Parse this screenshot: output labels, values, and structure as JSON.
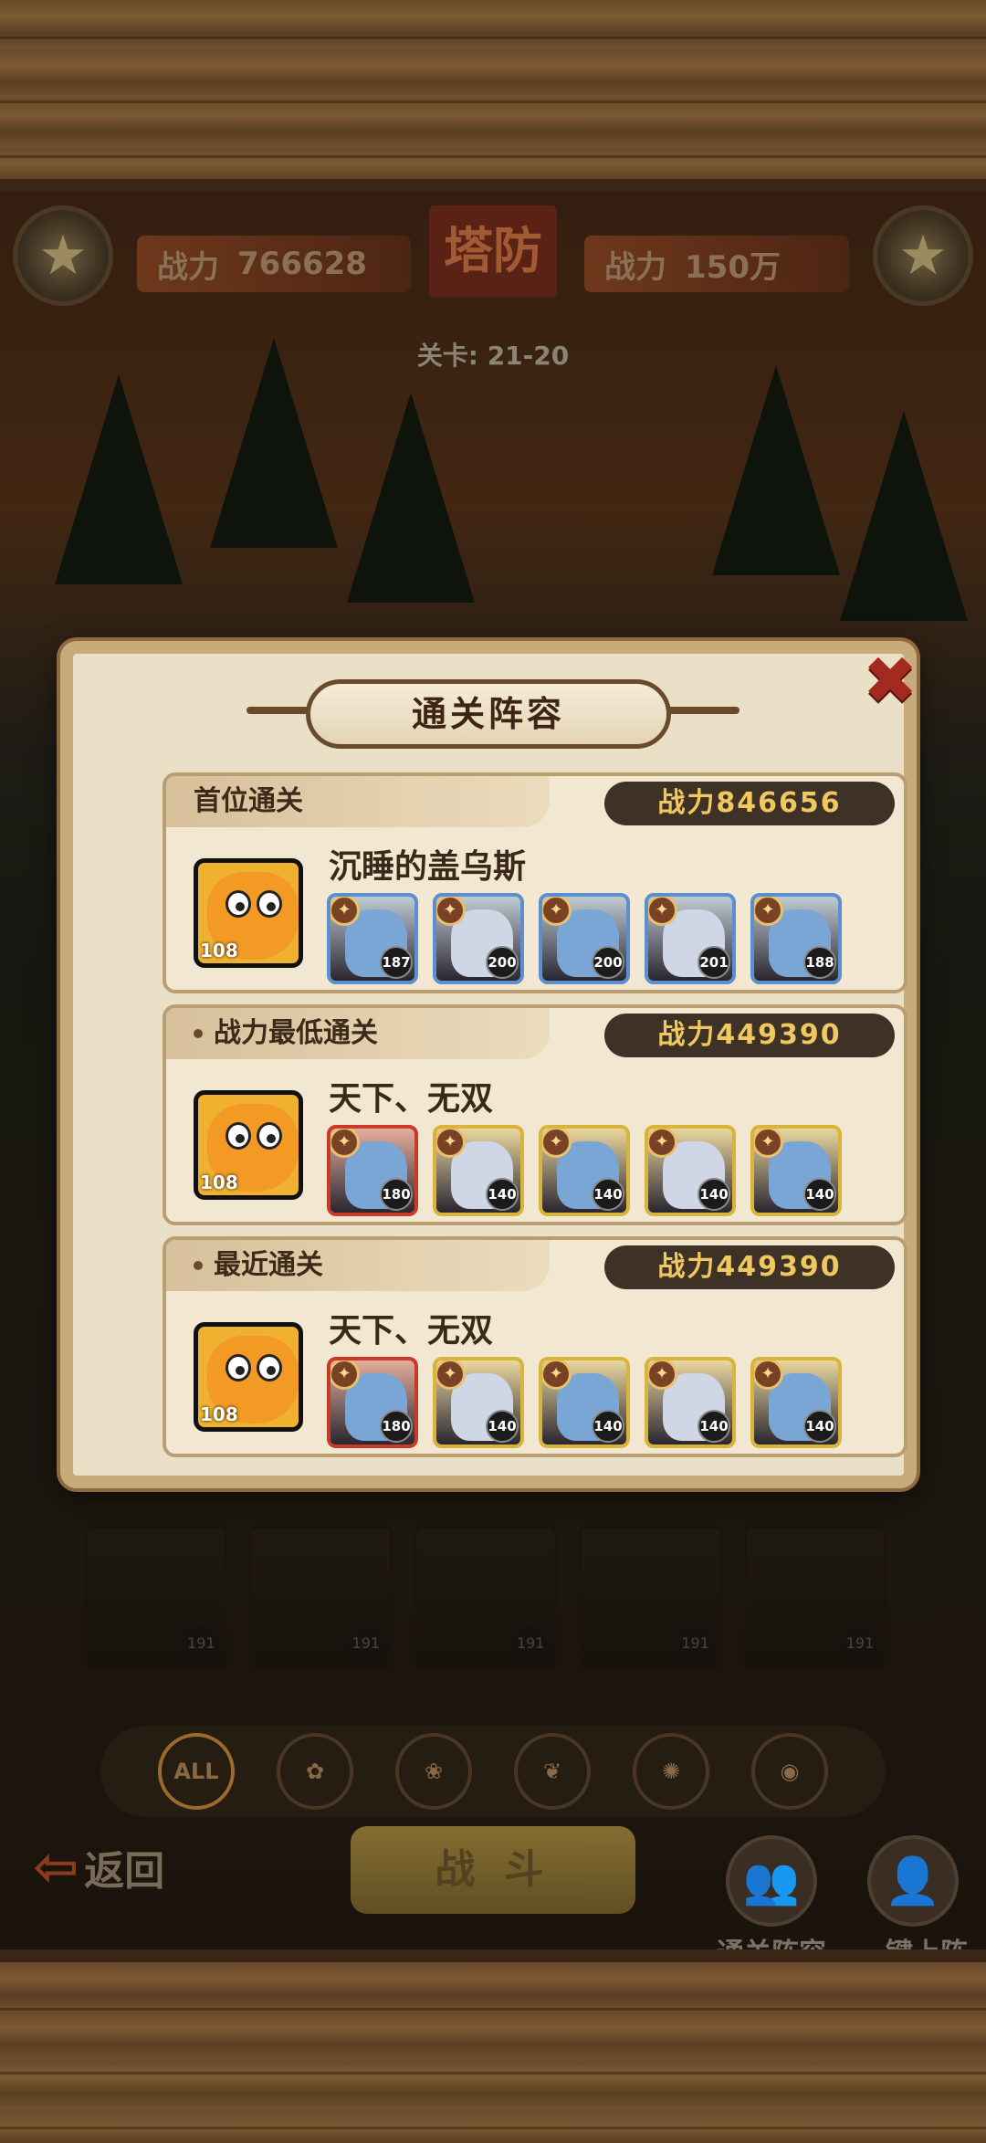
{
  "top_bar": {
    "left_power_label": "战力",
    "left_power_value": "766628",
    "title": "塔防",
    "right_power_label": "战力",
    "right_power_value": "150万",
    "stage": "关卡: 21-20"
  },
  "dialog": {
    "title": "通关阵容",
    "close_icon": "close-x-icon",
    "sections": [
      {
        "header": "首位通关",
        "power": "战力846656",
        "leader_level": "108",
        "player_name": "沉睡的盖乌斯",
        "heroes": [
          {
            "level": "187",
            "color": "#5b8fd0"
          },
          {
            "level": "200",
            "color": "#5b8fd0"
          },
          {
            "level": "200",
            "color": "#5b8fd0"
          },
          {
            "level": "201",
            "color": "#5b8fd0"
          },
          {
            "level": "188",
            "color": "#5b8fd0"
          }
        ]
      },
      {
        "header": "战力最低通关",
        "power": "战力449390",
        "leader_level": "108",
        "player_name": "天下、无双",
        "heroes": [
          {
            "level": "180",
            "color": "#c83a2a"
          },
          {
            "level": "140",
            "color": "#d8b43a"
          },
          {
            "level": "140",
            "color": "#d8b43a"
          },
          {
            "level": "140",
            "color": "#d8b43a"
          },
          {
            "level": "140",
            "color": "#d8b43a"
          }
        ]
      },
      {
        "header": "最近通关",
        "power": "战力449390",
        "leader_level": "108",
        "player_name": "天下、无双",
        "heroes": [
          {
            "level": "180",
            "color": "#c83a2a"
          },
          {
            "level": "140",
            "color": "#d8b43a"
          },
          {
            "level": "140",
            "color": "#d8b43a"
          },
          {
            "level": "140",
            "color": "#d8b43a"
          },
          {
            "level": "140",
            "color": "#d8b43a"
          }
        ]
      }
    ]
  },
  "roster_levels": [
    "191",
    "191",
    "191",
    "191",
    "191"
  ],
  "filters": [
    "ALL"
  ],
  "bottom": {
    "back_label": "返回",
    "fight_label": "战 斗",
    "lineup_label": "通关阵容",
    "auto_label": "一键上阵"
  }
}
